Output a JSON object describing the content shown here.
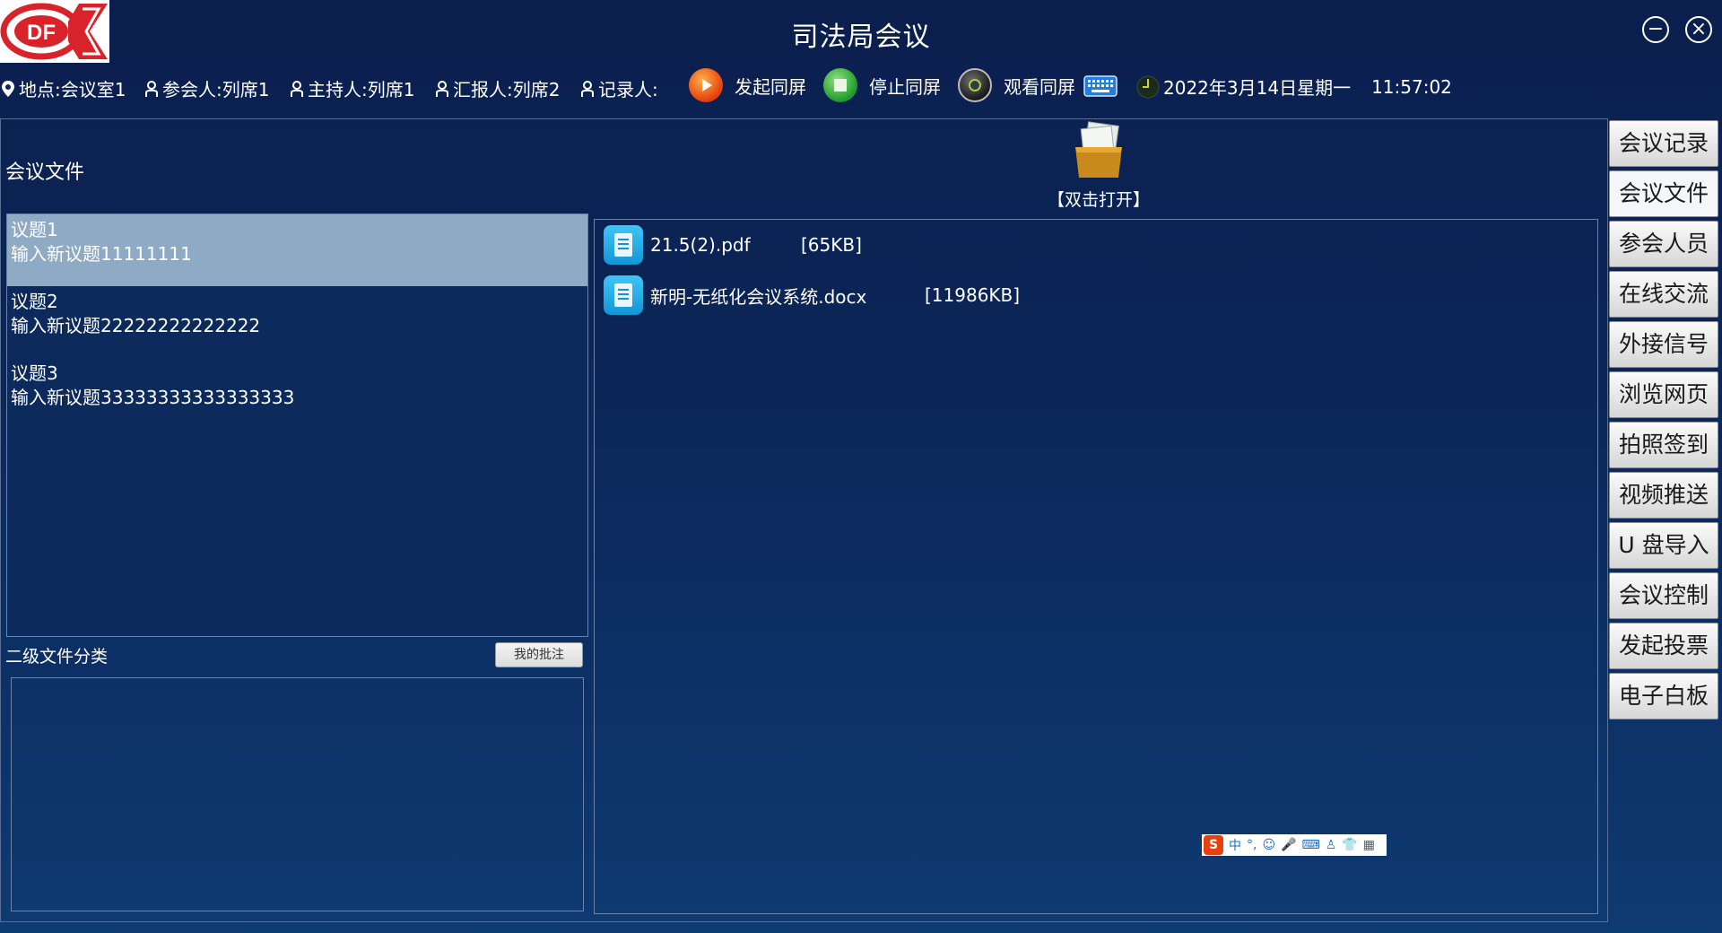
{
  "window": {
    "title": "司法局会议",
    "logo_text": "DF",
    "minimize_symbol": "−",
    "close_symbol": "×"
  },
  "infobar": {
    "location": "地点:会议室1",
    "participants": "参会人:列席1",
    "host": "主持人:列席1",
    "reporter": "汇报人:列席2",
    "recorder": "记录人:",
    "start_share": "发起同屏",
    "stop_share": "停止同屏",
    "watch_share": "观看同屏",
    "date": "2022年3月14日星期一",
    "time": "11:57:02"
  },
  "main": {
    "section_title": "会议文件",
    "open_hint": "【双击打开】",
    "topics": [
      {
        "title": "议题1",
        "desc": "输入新议题11111111"
      },
      {
        "title": "议题2",
        "desc": "输入新议题22222222222222"
      },
      {
        "title": "议题3",
        "desc": "输入新议题33333333333333333"
      }
    ],
    "sub_category_label": "二级文件分类",
    "annotation_button": "我的批注",
    "files": [
      {
        "name": "21.5(2).pdf",
        "size": "[65KB]"
      },
      {
        "name": "新明-无纸化会议系统.docx",
        "size": "[11986KB]"
      }
    ]
  },
  "ime": {
    "logo": "S",
    "mode": "中",
    "punct": "°,"
  },
  "side_menu": [
    "会议记录",
    "会议文件",
    "参会人员",
    "在线交流",
    "外接信号",
    "浏览网页",
    "拍照签到",
    "视频推送",
    "U 盘导入",
    "会议控制",
    "发起投票",
    "电子白板"
  ],
  "colors": {
    "background": "#0b2657",
    "selected_topic": "#8eaac4",
    "accent_red": "#d8232a"
  }
}
